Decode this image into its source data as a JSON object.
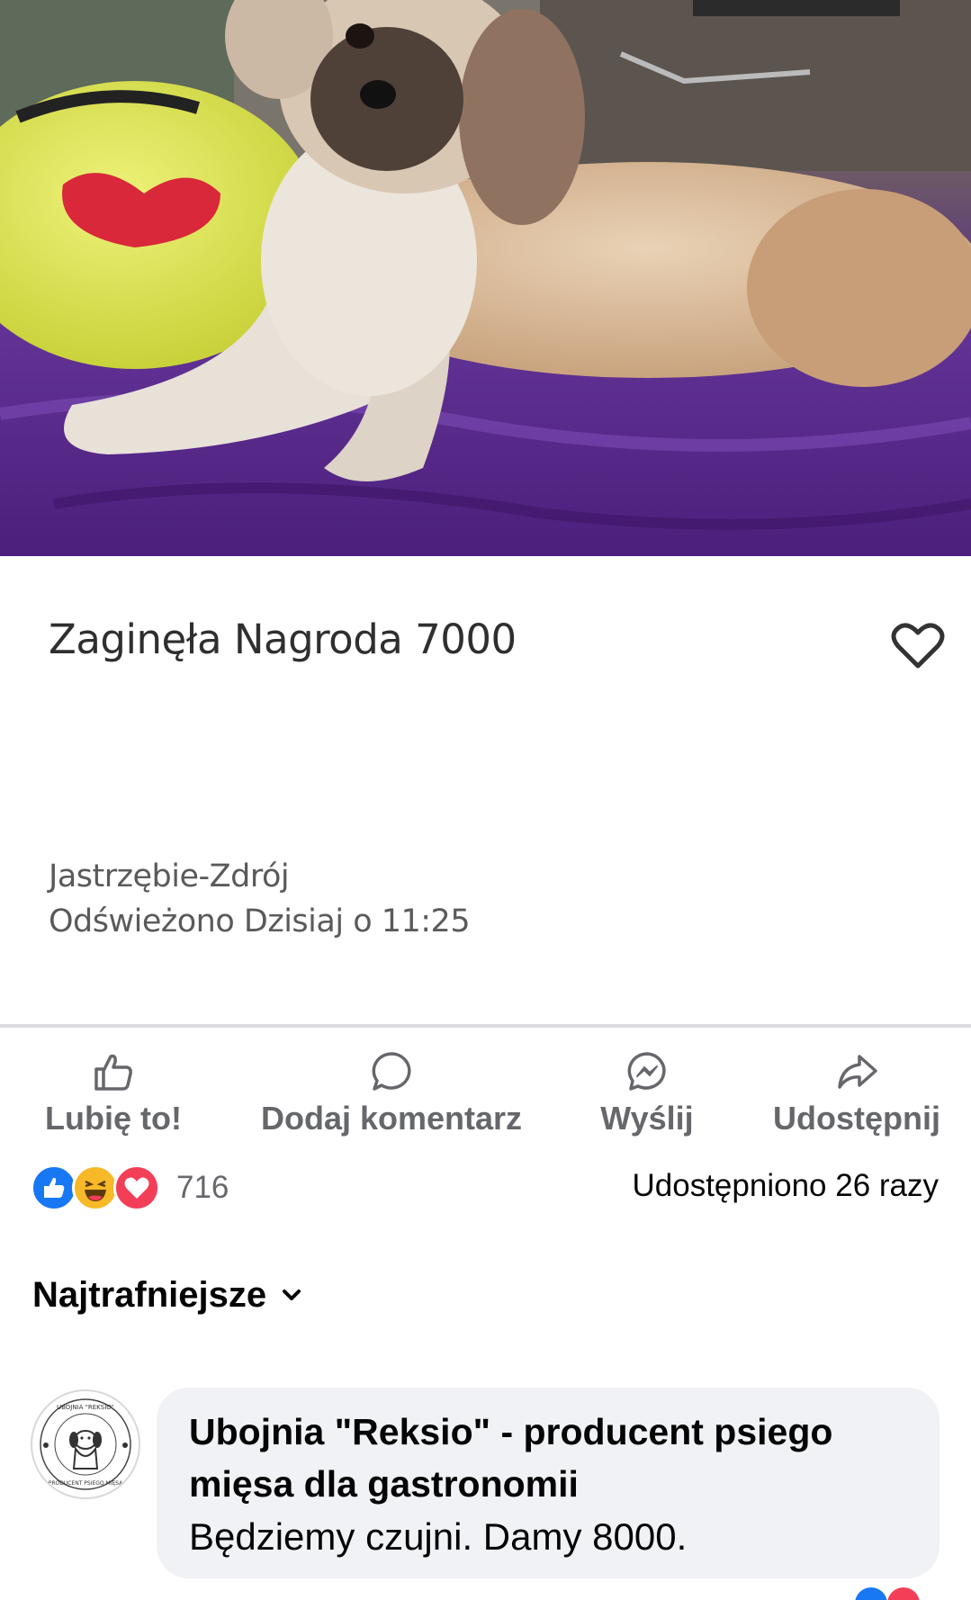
{
  "listing": {
    "title": "Zaginęła Nagroda 7000",
    "location": "Jastrzębie-Zdrój",
    "refreshed": "Odświeżono Dzisiaj o 11:25",
    "favorite_icon": "heart-outline-icon"
  },
  "actions": {
    "like": {
      "label": "Lubię to!",
      "icon": "thumbs-up-icon"
    },
    "comment": {
      "label": "Dodaj komentarz",
      "icon": "comment-bubble-icon"
    },
    "send": {
      "label": "Wyślij",
      "icon": "messenger-icon"
    },
    "share": {
      "label": "Udostępnij",
      "icon": "share-arrow-icon"
    }
  },
  "reactions": {
    "types": [
      "like",
      "haha",
      "love"
    ],
    "count": "716",
    "shares": "Udostępniono 26 razy"
  },
  "sort": {
    "label": "Najtrafniejsze",
    "icon": "chevron-down-icon"
  },
  "comment": {
    "author": "Ubojnia \"Reksio\" - producent psiego mięsa dla gastronomii",
    "text": "Będziemy czujni. Damy 8000.",
    "avatar_top_text": "UBOJNIA \"REKSIO\"",
    "avatar_bottom_text": "PRODUCENT PSIEGO MIĘSA"
  },
  "colors": {
    "facebook_blue": "#1877f2",
    "muted_text": "#65676b",
    "bubble_bg": "#f0f2f5",
    "blanket_purple": "#5b2f88"
  }
}
